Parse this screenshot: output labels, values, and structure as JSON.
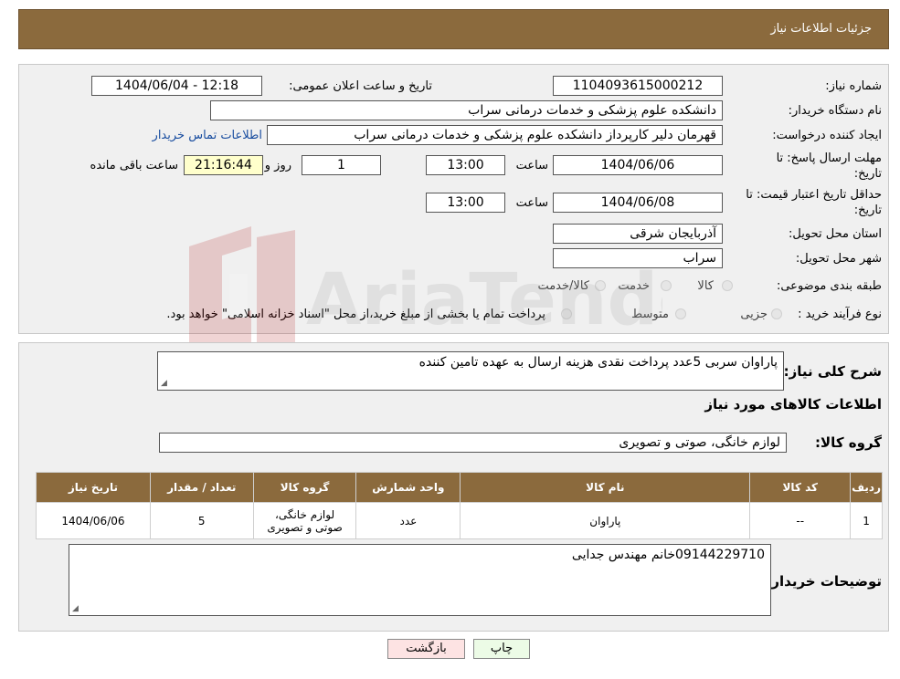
{
  "header": {
    "title": "جزئیات اطلاعات نیاز"
  },
  "form": {
    "need_number_label": "شماره نیاز:",
    "need_number": "1104093615000212",
    "announce_label": "تاریخ و ساعت اعلان عمومی:",
    "announce_value": "1404/06/04 - 12:18",
    "buyer_org_label": "نام دستگاه خریدار:",
    "buyer_org": "دانشکده علوم پزشکی و خدمات درمانی سراب",
    "creator_label": "ایجاد کننده درخواست:",
    "creator": "قهرمان دلیر کارپرداز دانشکده علوم پزشکی و خدمات درمانی سراب",
    "contact_link": "اطلاعات تماس خریدار",
    "deadline_label_1": "مهلت ارسال پاسخ: تا",
    "deadline_label_2": "تاریخ:",
    "deadline_date": "1404/06/06",
    "time_label": "ساعت",
    "deadline_time": "13:00",
    "days_value": "1",
    "days_label": "روز و",
    "remaining_time": "21:16:44",
    "remaining_label": "ساعت باقی مانده",
    "min_validity_label_1": "حداقل تاریخ اعتبار قیمت: تا",
    "min_validity_label_2": "تاریخ:",
    "min_validity_date": "1404/06/08",
    "min_validity_time": "13:00",
    "province_label": "استان محل تحویل:",
    "province": "آذربایجان شرقی",
    "city_label": "شهر محل تحویل:",
    "city": "سراب",
    "category_label": "طبقه بندی موضوعی:",
    "category_options": [
      "کالا",
      "خدمت",
      "کالا/خدمت"
    ],
    "process_label": "نوع فرآیند خرید :",
    "process_options": [
      "جزیی",
      "متوسط"
    ],
    "process_note": "پرداخت تمام یا بخشی از مبلغ خرید،از محل \"اسناد خزانه اسلامی\" خواهد بود."
  },
  "details": {
    "description_label": "شرح کلی نیاز:",
    "description": "پاراوان سربی 5عدد پرداخت نقدی هزینه ارسال به عهده تامین کننده",
    "items_title": "اطلاعات کالاهای مورد نیاز",
    "group_label": "گروه کالا:",
    "group_value": "لوازم خانگی، صوتی و تصویری",
    "table": {
      "headers": [
        "ردیف",
        "کد کالا",
        "نام کالا",
        "واحد شمارش",
        "گروه کالا",
        "تعداد / مقدار",
        "تاریخ نیاز"
      ],
      "rows": [
        [
          "1",
          "--",
          "پاراوان",
          "عدد",
          "لوازم خانگی، صوتی و تصویری",
          "5",
          "1404/06/06"
        ]
      ]
    },
    "buyer_notes_label": "توضیحات خریدار:",
    "buyer_notes": "09144229710خانم مهندس جدایی"
  },
  "buttons": {
    "print": "چاپ",
    "back": "بازگشت"
  },
  "watermark": {
    "text": "AriaTender.neT"
  },
  "colors": {
    "header": "#8b6a3d",
    "print_btn": "#ecfbe6",
    "back_btn": "#fde3e3",
    "link": "#1a4ea0"
  }
}
